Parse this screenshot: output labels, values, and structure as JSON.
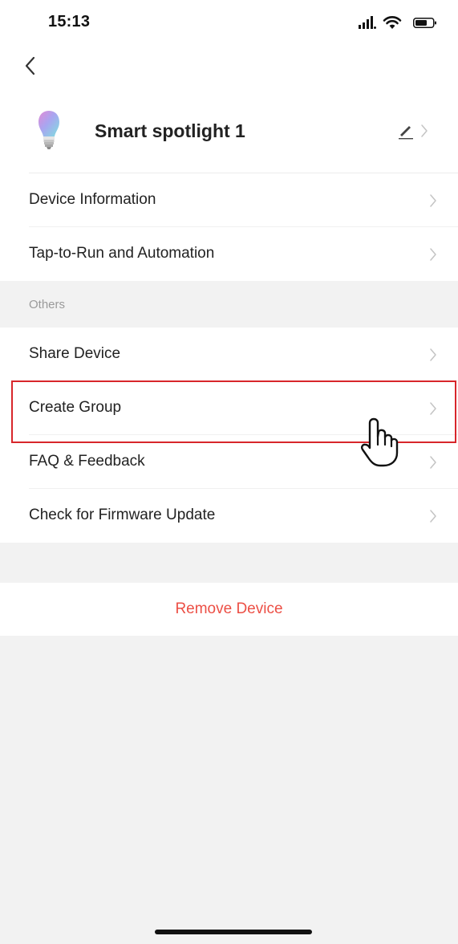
{
  "status_bar": {
    "time": "15:13",
    "icons": [
      "signal-icon",
      "wifi-icon",
      "battery-icon"
    ]
  },
  "nav": {
    "back_icon": "chevron-left-icon"
  },
  "device": {
    "name": "Smart spotlight 1",
    "icon": "bulb-icon",
    "edit_icon": "pencil-icon"
  },
  "top_items": [
    {
      "label": "Device Information"
    },
    {
      "label": "Tap-to-Run and Automation"
    }
  ],
  "others_section": {
    "title": "Others",
    "items": [
      {
        "label": "Share Device"
      },
      {
        "label": "Create Group",
        "highlighted": true
      },
      {
        "label": "FAQ & Feedback"
      },
      {
        "label": "Check for Firmware Update"
      }
    ]
  },
  "remove": {
    "label": "Remove Device",
    "color": "#ec4f45"
  },
  "colors": {
    "highlight": "#d8262b",
    "background": "#f2f2f2",
    "surface": "#ffffff"
  }
}
